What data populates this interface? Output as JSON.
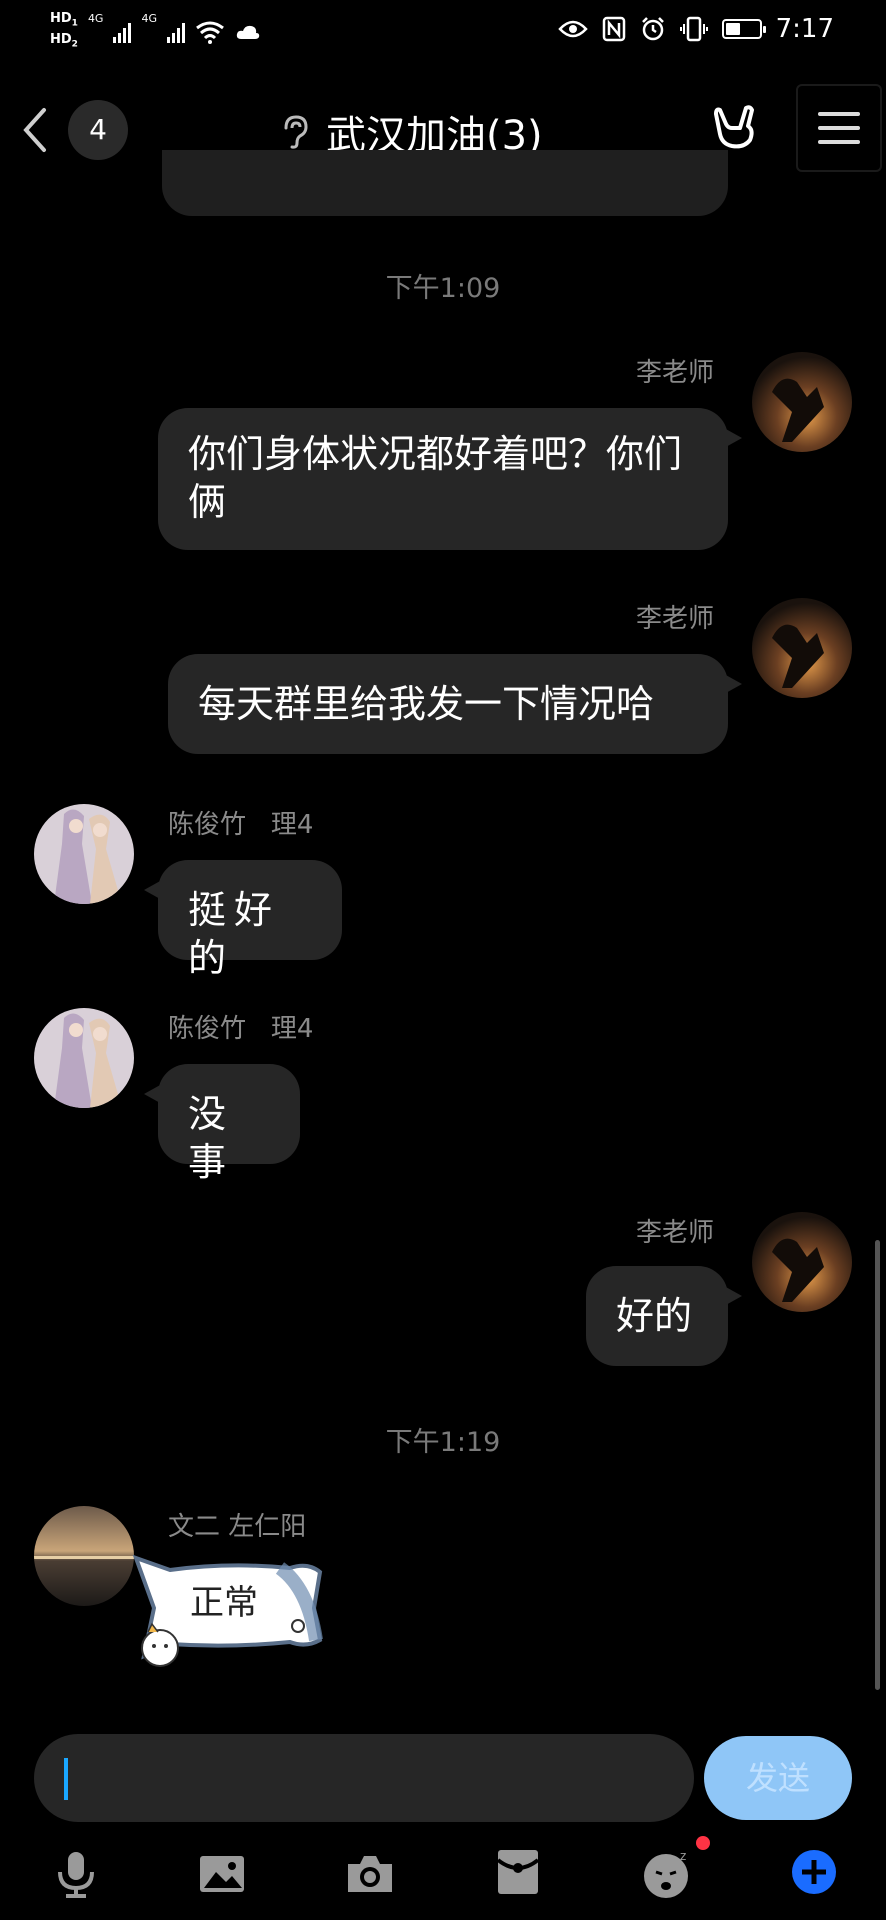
{
  "status_bar": {
    "sim1": "HD",
    "sim1_index": "1",
    "sim2": "HD",
    "sim2_index": "2",
    "net1": "4G",
    "net2": "4G",
    "time": "7:17",
    "battery_level": 0.4,
    "icons": [
      "eye-icon",
      "nfc-icon",
      "alarm-icon",
      "vibrate-icon",
      "battery-icon"
    ]
  },
  "header": {
    "unread_count": "4",
    "title": "武汉加油(3)",
    "icons": [
      "back-icon",
      "ear-icon",
      "rock-hand-icon",
      "menu-icon"
    ]
  },
  "messages": [
    {
      "type": "time",
      "text": "下午1:09"
    },
    {
      "type": "msg",
      "side": "right",
      "sender": "李老师",
      "text": "你们身体状况都好着吧？你们俩"
    },
    {
      "type": "msg",
      "side": "right",
      "sender": "李老师",
      "text": "每天群里给我发一下情况哈"
    },
    {
      "type": "msg",
      "side": "left",
      "sender": "陈俊竹",
      "tag": "理4",
      "text": "挺好的"
    },
    {
      "type": "msg",
      "side": "left",
      "sender": "陈俊竹",
      "tag": "理4",
      "text": "没事"
    },
    {
      "type": "msg",
      "side": "right",
      "sender": "李老师",
      "text": "好的"
    },
    {
      "type": "time",
      "text": "下午1:19"
    },
    {
      "type": "sticker",
      "side": "left",
      "sender": "文二 左仁阳",
      "text": "正常"
    }
  ],
  "input": {
    "value": "",
    "send_label": "发送"
  },
  "toolbar": {
    "icons": [
      "microphone-icon",
      "image-icon",
      "camera-icon",
      "red-packet-icon",
      "emoji-icon",
      "plus-icon"
    ]
  },
  "colors": {
    "background": "#000000",
    "bubble": "#262626",
    "send_button": "#8fc6f7",
    "caret": "#1aa7ff",
    "plus": "#1a6cff",
    "badge_dot": "#ff3344"
  }
}
